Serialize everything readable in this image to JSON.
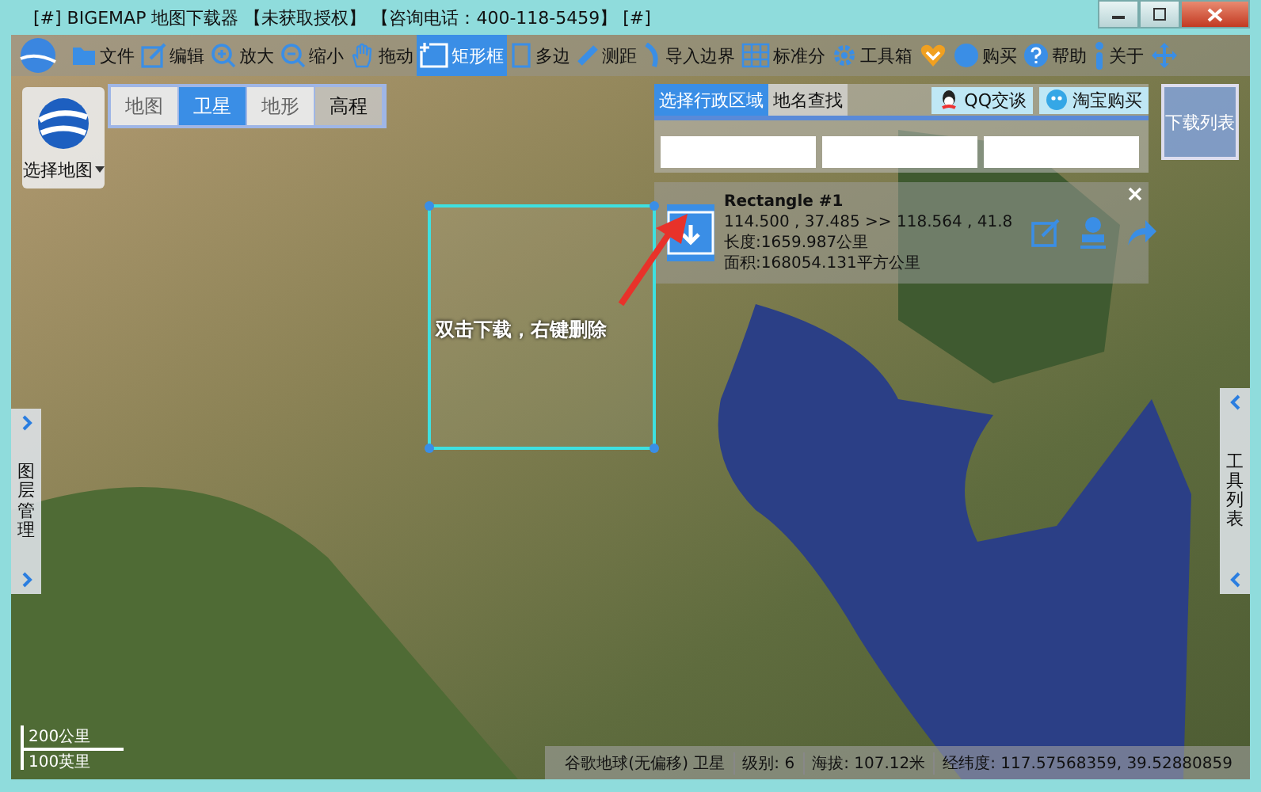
{
  "window": {
    "title": "[#] BIGEMAP 地图下载器 【未获取授权】 【咨询电话：400-118-5459】 [#]"
  },
  "toolbar": [
    {
      "kind": "folder",
      "label": "文件",
      "selected": false
    },
    {
      "kind": "edit",
      "label": "编辑",
      "selected": false
    },
    {
      "kind": "zoom-in",
      "label": "放大",
      "selected": false
    },
    {
      "kind": "zoom-out",
      "label": "缩小",
      "selected": false
    },
    {
      "kind": "hand",
      "label": "拖动",
      "selected": false
    },
    {
      "kind": "rect",
      "label": "矩形框",
      "selected": true
    },
    {
      "kind": "polygon",
      "label": "多边",
      "selected": false
    },
    {
      "kind": "ruler",
      "label": "测距",
      "selected": false
    },
    {
      "kind": "import",
      "label": "导入边界",
      "selected": false
    },
    {
      "kind": "grid",
      "label": "标准分",
      "selected": false
    },
    {
      "kind": "gear",
      "label": "工具箱",
      "selected": false
    },
    {
      "kind": "heart",
      "selected": false
    },
    {
      "kind": "cart",
      "label": "购买",
      "selected": false
    },
    {
      "kind": "help",
      "label": "帮助",
      "selected": false
    },
    {
      "kind": "info",
      "label": "关于",
      "selected": false
    },
    {
      "kind": "move",
      "selected": false
    }
  ],
  "map_types": [
    {
      "label": "地图",
      "selected": false,
      "disabled": true
    },
    {
      "label": "卫星",
      "selected": true,
      "disabled": false
    },
    {
      "label": "地形",
      "selected": false,
      "disabled": true
    },
    {
      "label": "高程",
      "selected": false,
      "disabled": false
    }
  ],
  "map_selector": {
    "label": "选择地图"
  },
  "search_panel": {
    "tabs": [
      {
        "label": "选择行政区域",
        "selected": true
      },
      {
        "label": "地名查找",
        "selected": false
      }
    ],
    "links": [
      {
        "kind": "qq",
        "label": "QQ交谈"
      },
      {
        "kind": "taobao",
        "label": "淘宝购买"
      }
    ],
    "fields": [
      {
        "kind": "dropdown"
      },
      {
        "kind": "dropdown"
      },
      {
        "kind": "dropdown"
      }
    ]
  },
  "download_list_button": {
    "label": "下载列表"
  },
  "shape_card": {
    "title": "Rectangle #1",
    "coords": "114.500 , 37.485 >> 118.564 , 41.8",
    "length": "长度:1659.987公里",
    "area": "面积:168054.131平方公里"
  },
  "selection": {
    "hint": "双击下载，右键删除"
  },
  "side_tabs": [
    {
      "label": "图层管理"
    },
    {
      "label": "工具列表"
    }
  ],
  "scale": [
    "200公里",
    "100英里"
  ],
  "status_bar": [
    "谷歌地球(无偏移) 卫星",
    "级别: 6",
    "海拔: 107.12米",
    "经纬度: 117.57568359, 39.52880859"
  ]
}
